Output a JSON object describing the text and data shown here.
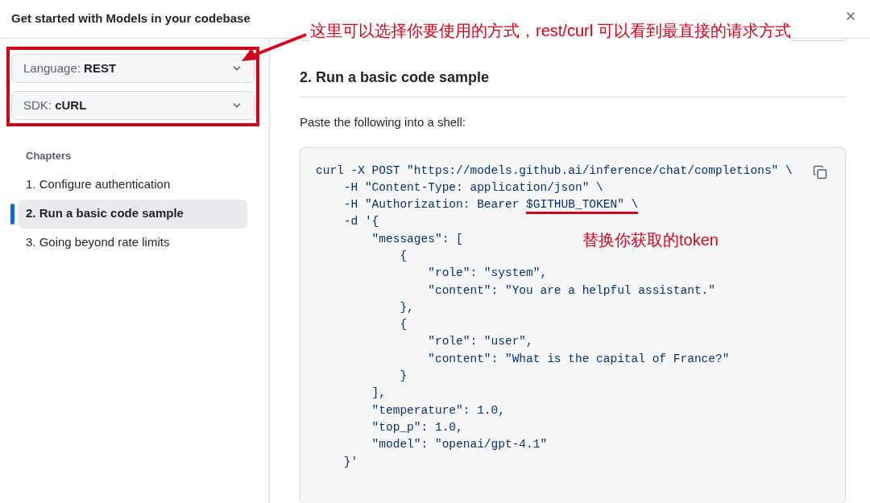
{
  "dialog": {
    "title": "Get started with Models in your codebase"
  },
  "sidebar": {
    "selects": [
      {
        "label": "Language:",
        "value": "REST"
      },
      {
        "label": "SDK:",
        "value": "cURL"
      }
    ],
    "chapters_heading": "Chapters",
    "chapters": [
      {
        "label": "1. Configure authentication",
        "selected": false
      },
      {
        "label": "2. Run a basic code sample",
        "selected": true
      },
      {
        "label": "3. Going beyond rate limits",
        "selected": false
      }
    ]
  },
  "content": {
    "heading": "2. Run a basic code sample",
    "intro": "Paste the following into a shell:",
    "code_lines": [
      "curl -X POST \"https://models.github.ai/inference/chat/completions\" \\",
      "    -H \"Content-Type: application/json\" \\",
      "    -H \"Authorization: Bearer $GITHUB_TOKEN\" \\",
      "    -d '{",
      "        \"messages\": [",
      "            {",
      "                \"role\": \"system\",",
      "                \"content\": \"You are a helpful assistant.\"",
      "            },",
      "            {",
      "                \"role\": \"user\",",
      "                \"content\": \"What is the capital of France?\"",
      "            }",
      "        ],",
      "        \"temperature\": 1.0,",
      "        \"top_p\": 1.0,",
      "        \"model\": \"openai/gpt-4.1\"",
      "    }'"
    ]
  },
  "annotations": {
    "selector_note": "这里可以选择你要使用的方式，rest/curl 可以看到最直接的请求方式",
    "token_note": "替换你获取的token"
  }
}
